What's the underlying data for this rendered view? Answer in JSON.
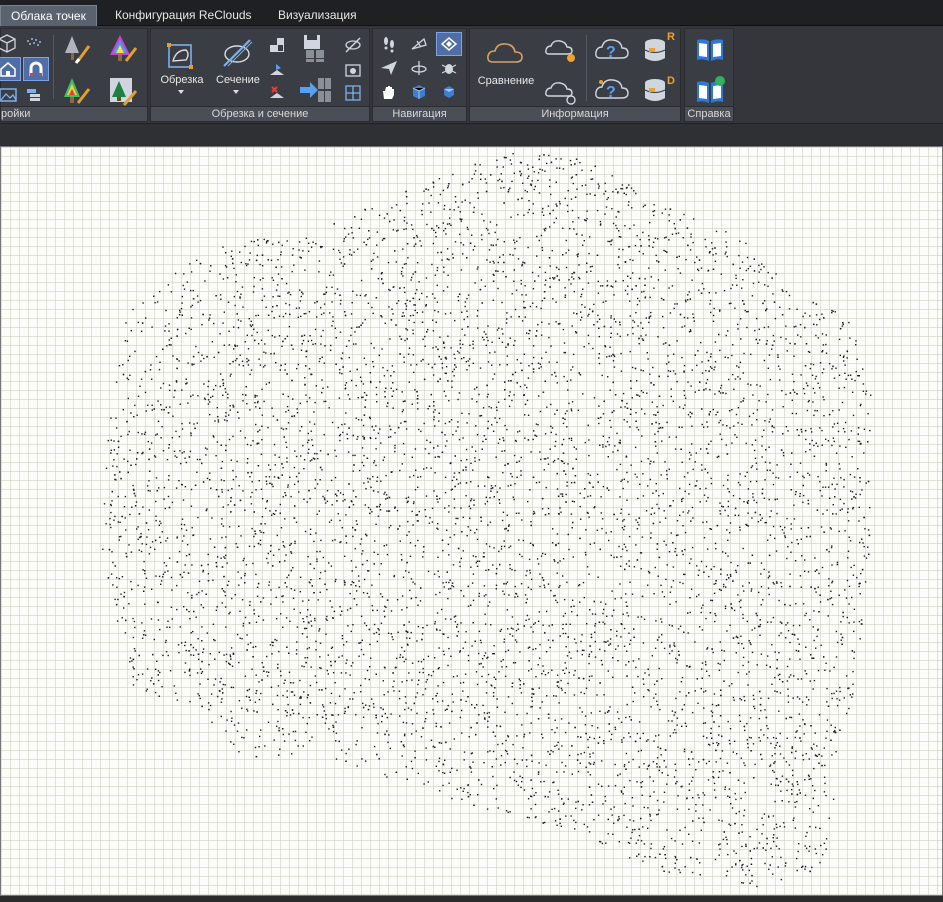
{
  "tabs": [
    {
      "label": "Облака точек",
      "active": true
    },
    {
      "label": "Конфигурация ReClouds",
      "active": false
    },
    {
      "label": "Визуализация",
      "active": false
    }
  ],
  "panels": {
    "settings": {
      "title": "ройки"
    },
    "clip": {
      "title": "Обрезка и сечение",
      "clip_label": "Обрезка",
      "section_label": "Сечение"
    },
    "navigation": {
      "title": "Навигация"
    },
    "info": {
      "title": "Информация",
      "compare_label": "Сравнение",
      "r_badge": "R",
      "d_badge": "D"
    },
    "help": {
      "title": "Справка"
    }
  },
  "colors": {
    "accent": "#4f6ea8",
    "point": "#1a1a1a",
    "viewport_bg": "#fcfcf8"
  },
  "icons": [
    "cube-icon",
    "dots-icon",
    "tree-brush-icon",
    "rainbow-tree-brush-icon",
    "house-icon",
    "magnet-icon",
    "picture-icon",
    "layers-icon",
    "cube-clip-icon",
    "pencil-slash-icon",
    "plane-clip-icon",
    "save-icon",
    "nav-footprints-icon",
    "paper-plane-icon",
    "hand-icon",
    "orbit-icon",
    "cloud-icon",
    "help-cloud-icon",
    "database-icon",
    "book-icon"
  ]
}
